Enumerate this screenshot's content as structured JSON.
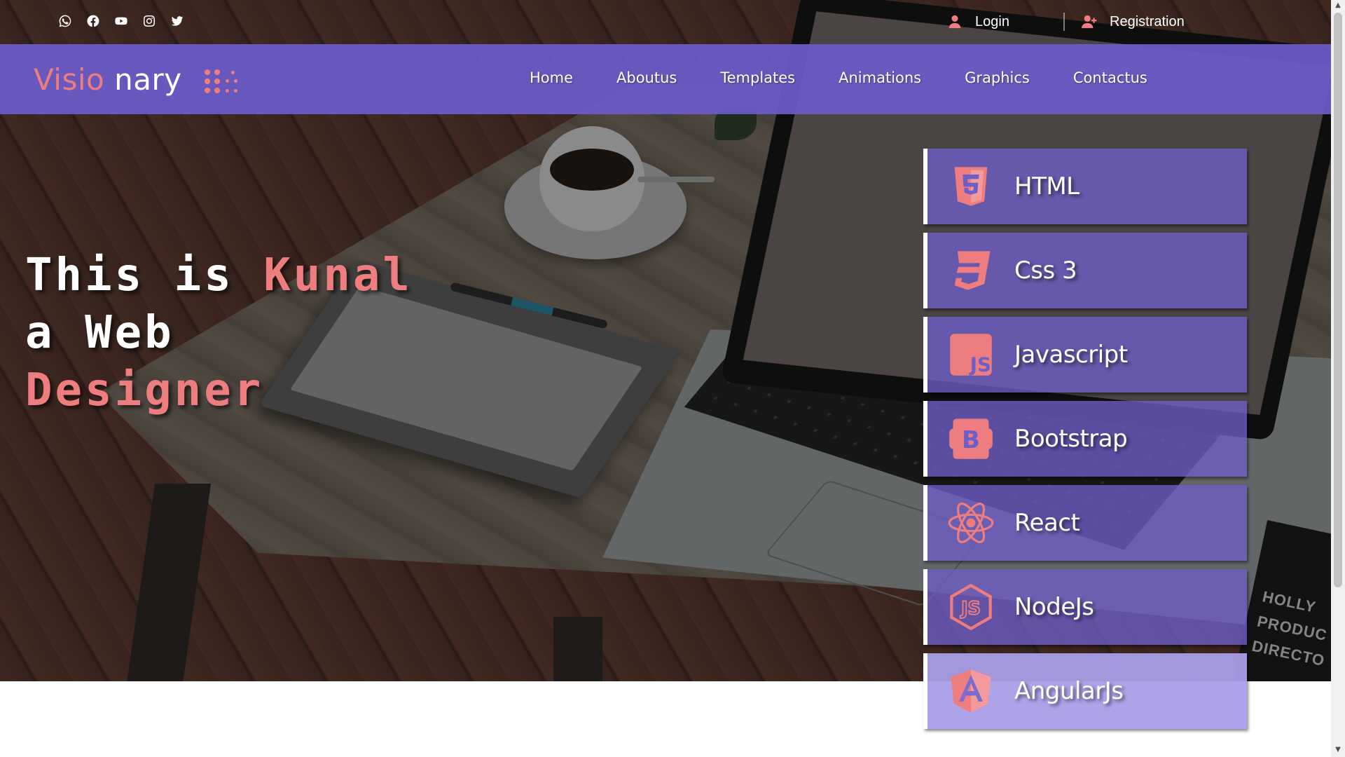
{
  "social": [
    {
      "icon": "whatsapp-icon"
    },
    {
      "icon": "facebook-icon"
    },
    {
      "icon": "youtube-icon"
    },
    {
      "icon": "instagram-icon"
    },
    {
      "icon": "twitter-icon"
    }
  ],
  "auth": {
    "login_label": "Login",
    "register_label": "Registration"
  },
  "logo": {
    "part1": "Visio",
    "part2": " nary"
  },
  "nav": {
    "items": [
      "Home",
      "Aboutus",
      "Templates",
      "Animations",
      "Graphics",
      "Contactus"
    ]
  },
  "headline": {
    "line1_prefix": "This is ",
    "line1_highlight": "Kunal",
    "line2": "a Web",
    "line3_highlight": "Designer"
  },
  "skills": [
    {
      "label": "HTML",
      "icon": "html5-icon"
    },
    {
      "label": "Css 3",
      "icon": "css3-icon"
    },
    {
      "label": "Javascript",
      "icon": "javascript-icon"
    },
    {
      "label": "Bootstrap",
      "icon": "bootstrap-icon"
    },
    {
      "label": "React",
      "icon": "react-icon"
    },
    {
      "label": "NodeJs",
      "icon": "nodejs-icon"
    },
    {
      "label": "AngularJs",
      "icon": "angular-icon"
    }
  ],
  "background_text": {
    "clapper_line1": "HOLLY",
    "clapper_line2": "PRODUC",
    "clapper_line3": "DIRECTO"
  },
  "colors": {
    "accent": "#ee7d80",
    "nav_bg": "#6c5ccb",
    "card_bg": "#6e5ec8",
    "text": "#ffffff"
  }
}
